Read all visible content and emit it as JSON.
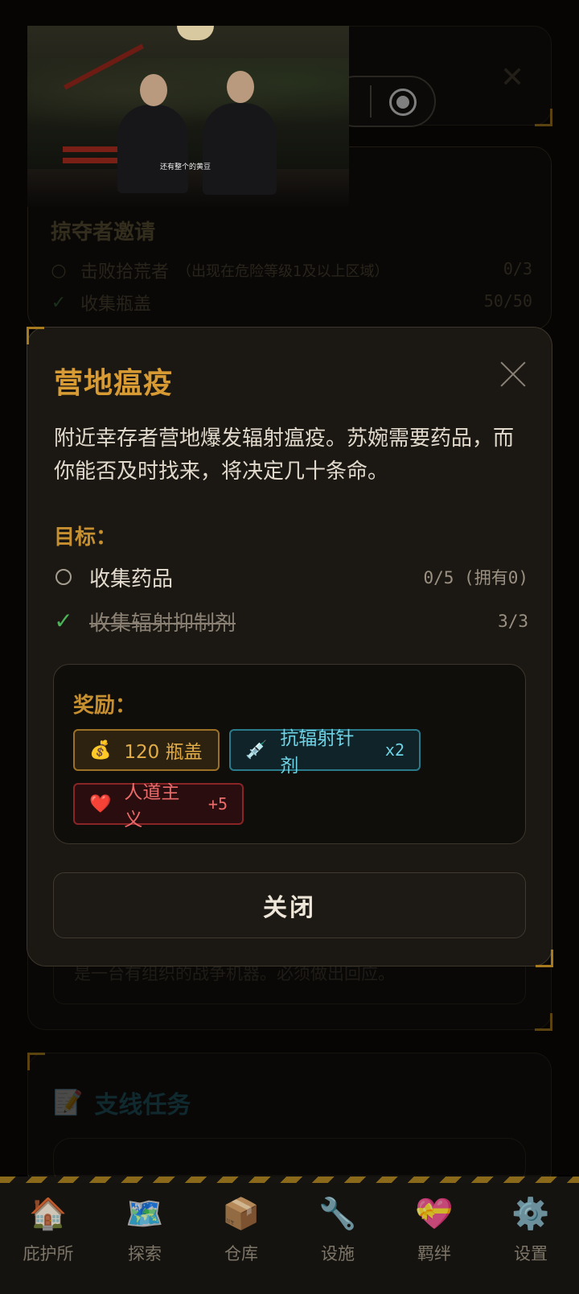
{
  "background": {
    "quest_title": "掠夺者邀请",
    "objectives": [
      {
        "name": "击败拾荒者",
        "note": "（出现在危险等级1及以上区域）",
        "count": "0/3",
        "done": false
      },
      {
        "name": "收集瓶盖",
        "note": "",
        "count": "50/50",
        "done": true
      }
    ],
    "lower_text": "是一台有组织的战争机器。必须做出回应。",
    "side_section_icon": "📝",
    "side_section_title": "支线任务",
    "close_glyph": "✕"
  },
  "video": {
    "caption": "还有整个的黄豆"
  },
  "modal": {
    "title": "营地瘟疫",
    "description": "附近幸存者营地爆发辐射瘟疫。苏婉需要药品，而你能否及时找来，将决定几十条命。",
    "objectives_label": "目标：",
    "objectives": [
      {
        "name": "收集药品",
        "count": "0/5 (拥有0)",
        "done": false,
        "check": "✓"
      },
      {
        "name": "收集辐射抑制剂",
        "count": "3/3",
        "done": true,
        "check": "✓"
      }
    ],
    "rewards_label": "奖励：",
    "rewards": [
      {
        "icon": "💰",
        "text": "120 瓶盖",
        "qty": "",
        "style": "gold"
      },
      {
        "icon": "💉",
        "text": "抗辐射针剂",
        "qty": "x2",
        "style": "cyan"
      },
      {
        "icon": "❤️",
        "text": "人道主义",
        "qty": "+5",
        "style": "red"
      }
    ],
    "close_button": "关闭"
  },
  "nav": [
    {
      "icon": "🏠",
      "label": "庇护所"
    },
    {
      "icon": "🗺️",
      "label": "探索"
    },
    {
      "icon": "📦",
      "label": "仓库"
    },
    {
      "icon": "🔧",
      "label": "设施"
    },
    {
      "icon": "💝",
      "label": "羁绊"
    },
    {
      "icon": "⚙️",
      "label": "设置"
    }
  ],
  "colors": {
    "accent_gold": "#d89b34",
    "success_green": "#4db35a",
    "reward_cyan": "#6fd3e6",
    "reward_red": "#eb6b6b"
  }
}
